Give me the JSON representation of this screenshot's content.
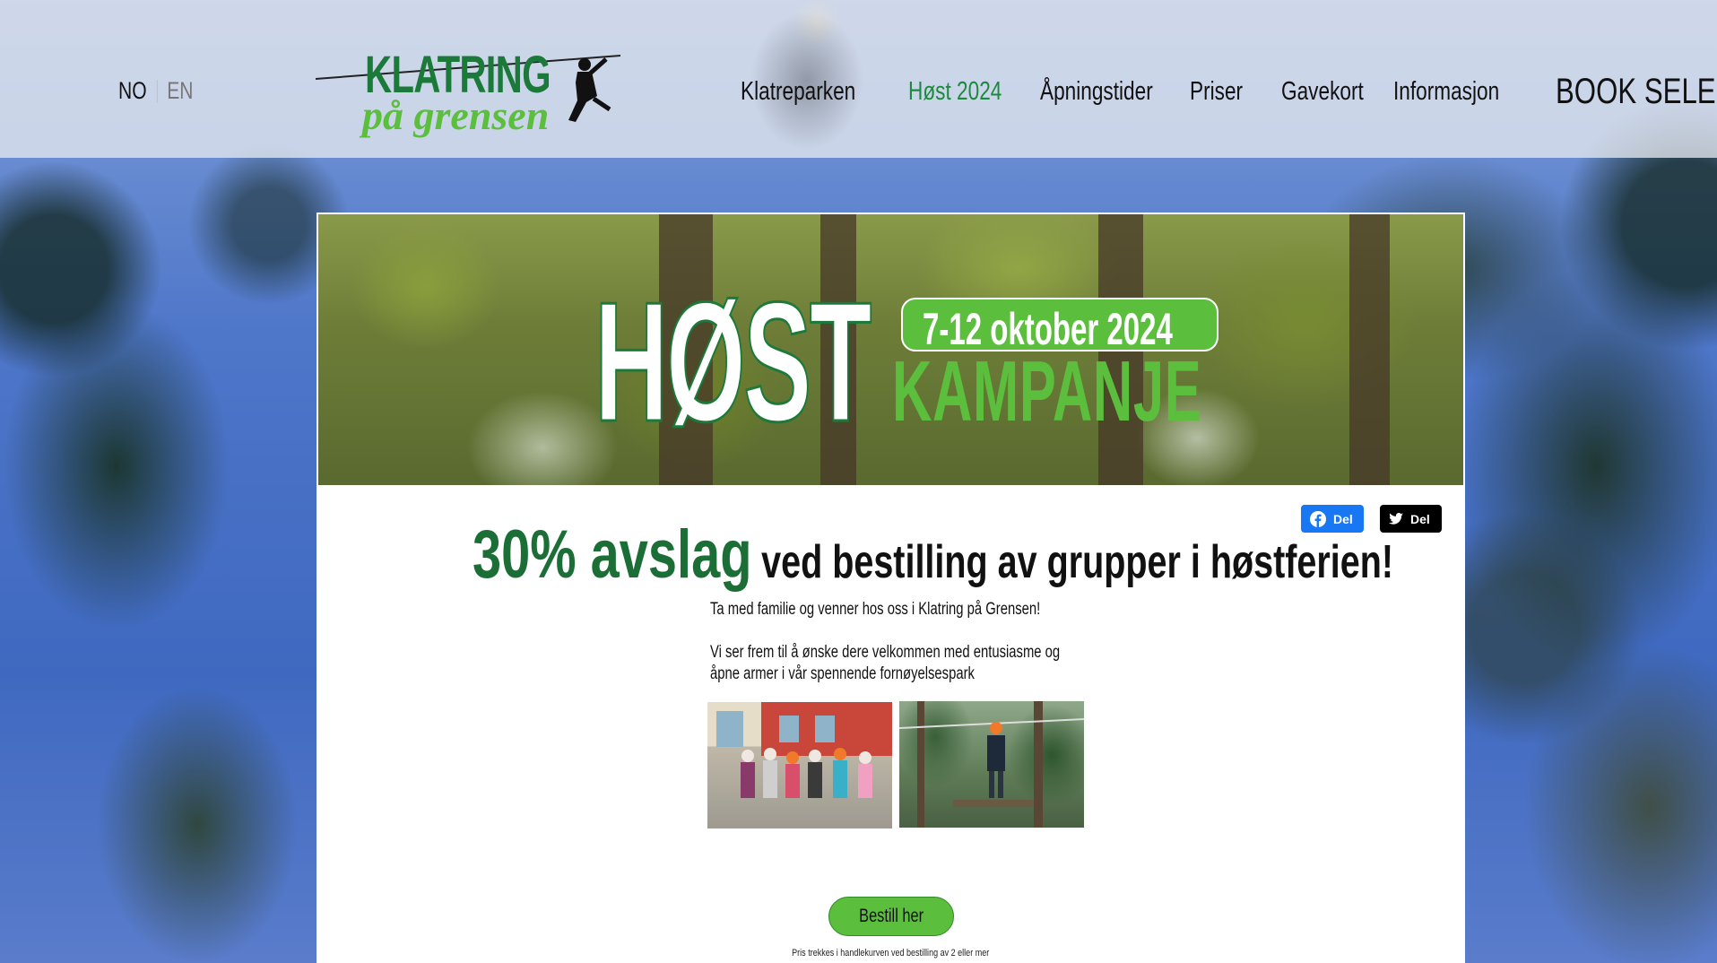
{
  "lang": {
    "no": "NO",
    "en": "EN"
  },
  "logo": {
    "title": "KLATRING",
    "subtitle": "på grensen"
  },
  "nav": {
    "items": [
      "Klatreparken",
      "Høst 2024",
      "Åpningstider",
      "Priser",
      "Gavekort",
      "Informasjon"
    ],
    "active": "Høst 2024",
    "book": "BOOK SELE"
  },
  "banner": {
    "big": "HØST",
    "date": "7-12 oktober  2024",
    "kampanje": "KAMPANJE"
  },
  "share": {
    "facebook": "Del",
    "twitter": "Del"
  },
  "headline": {
    "green": "30% avslag",
    "black": "ved bestilling av grupper i høstferien!"
  },
  "body": {
    "line1": "Ta med familie og venner hos oss i Klatring på Grensen!",
    "line2": "Vi ser frem til å ønske dere velkommen med entusiasme og",
    "line3": "åpne armer i vår spennende fornøyelsespark"
  },
  "order_button": "Bestill her",
  "note": "Pris trekkes i handlekurven ved bestilling av 2 eller mer",
  "colors": {
    "brand_green": "#1b7a3a",
    "accent_green": "#5bbf3d"
  }
}
